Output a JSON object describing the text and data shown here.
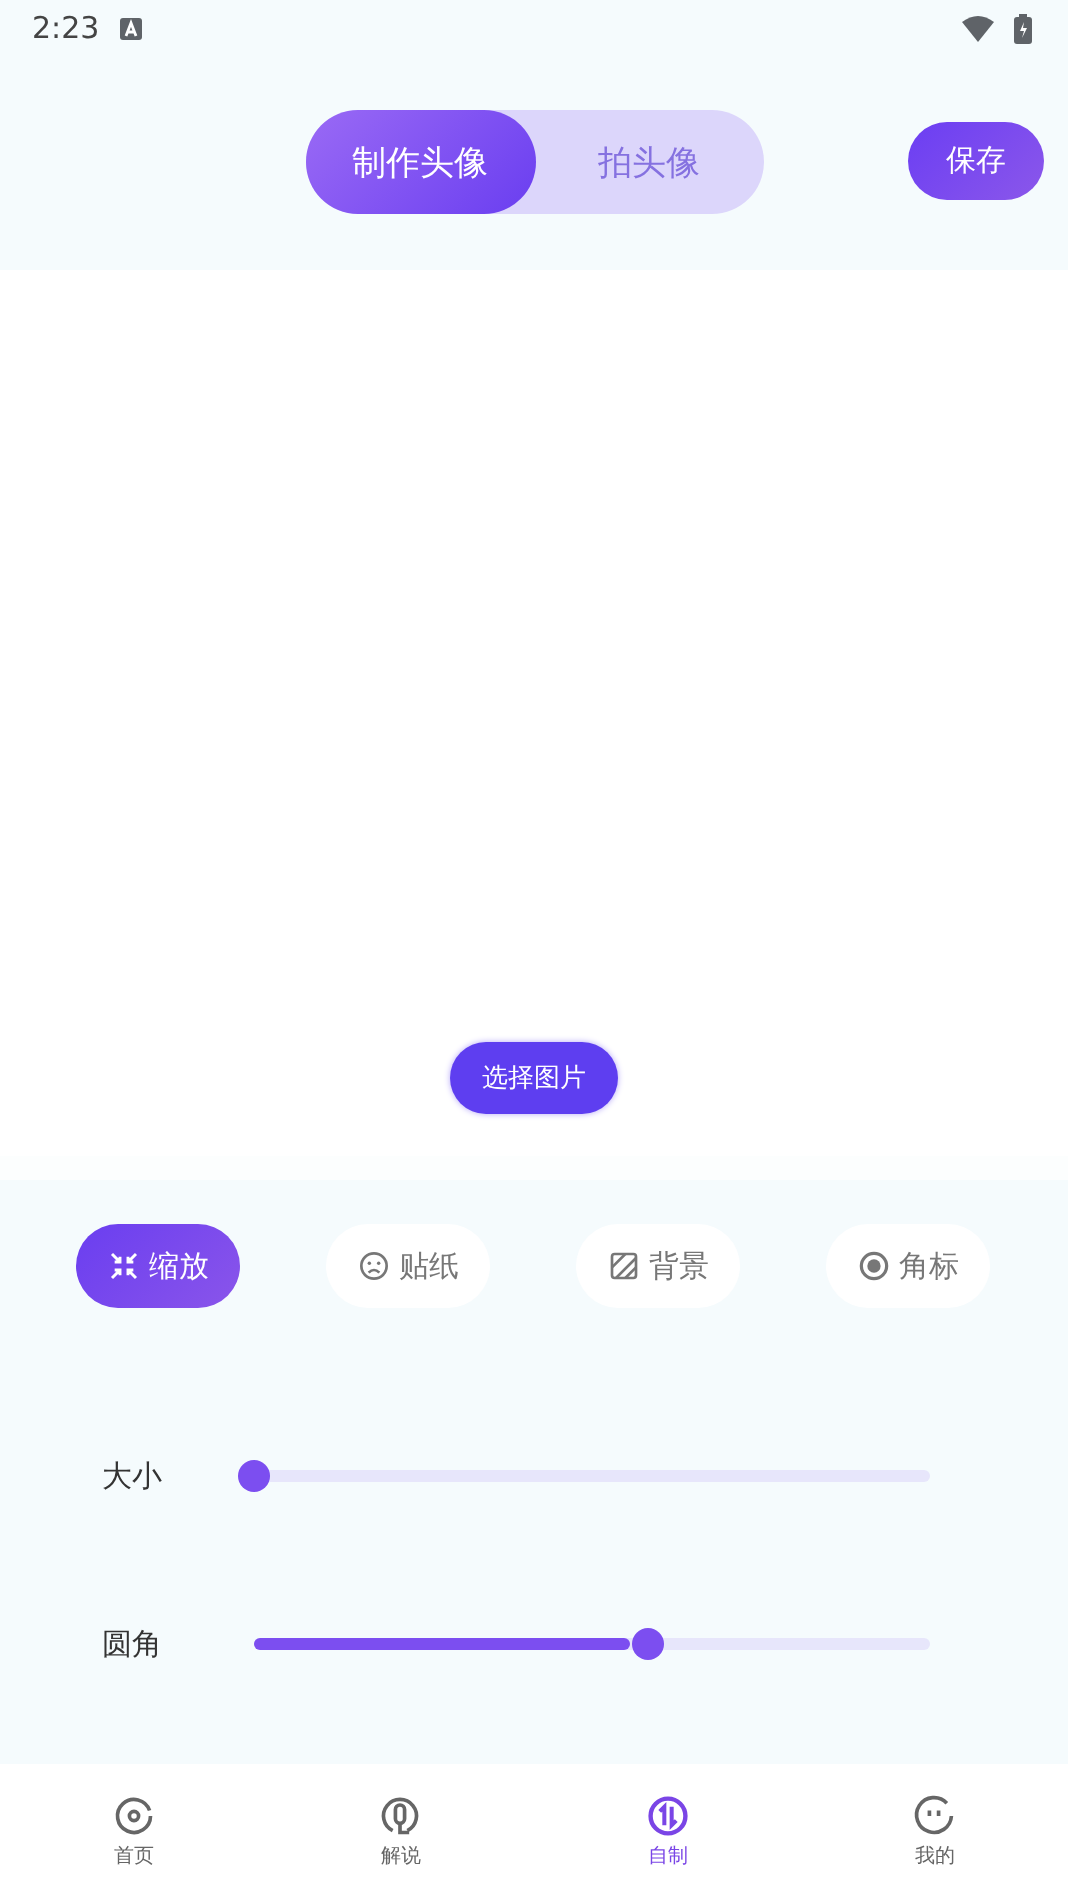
{
  "status_bar": {
    "time": "2:23"
  },
  "mode_tabs": [
    {
      "label": "制作头像",
      "selected": true
    },
    {
      "label": "拍头像",
      "selected": false
    }
  ],
  "save_button": "保存",
  "select_image_button": "选择图片",
  "tools": [
    {
      "label": "缩放",
      "kind": "shrink",
      "selected": true
    },
    {
      "label": "贴纸",
      "kind": "face",
      "selected": false
    },
    {
      "label": "背景",
      "kind": "hatch",
      "selected": false
    },
    {
      "label": "角标",
      "kind": "dot",
      "selected": false
    }
  ],
  "sliders": [
    {
      "label": "大小",
      "level": 0
    },
    {
      "label": "圆角",
      "level": 0.556
    }
  ],
  "nav": [
    {
      "label": "首页",
      "kind": "disc",
      "selected": false
    },
    {
      "label": "解说",
      "kind": "mic",
      "selected": false
    },
    {
      "label": "自制",
      "kind": "swap",
      "selected": true
    },
    {
      "label": "我的",
      "kind": "smile",
      "selected": false
    }
  ]
}
